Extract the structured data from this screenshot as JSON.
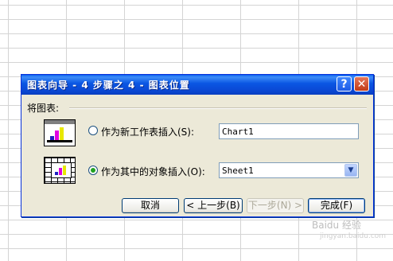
{
  "dialog": {
    "title": "图表向导 - 4 步骤之 4 - 图表位置",
    "help_symbol": "?",
    "close_symbol": "✕",
    "group_label": "将图表:",
    "options": [
      {
        "label": "作为新工作表插入(S):",
        "value": "Chart1",
        "selected": false
      },
      {
        "label": "作为其中的对象插入(O):",
        "value": "Sheet1",
        "selected": true
      }
    ],
    "buttons": {
      "cancel": "取消",
      "back": "< 上一步(B)",
      "next": "下一步(N) >",
      "finish": "完成(F)"
    }
  },
  "watermark": "Baidu 经验",
  "watermark_sub": "jingyan.baidu.com",
  "colors": {
    "titlebar": "#0a56e3",
    "dialog_bg": "#ece9d8",
    "radio_dot": "#21a121"
  }
}
